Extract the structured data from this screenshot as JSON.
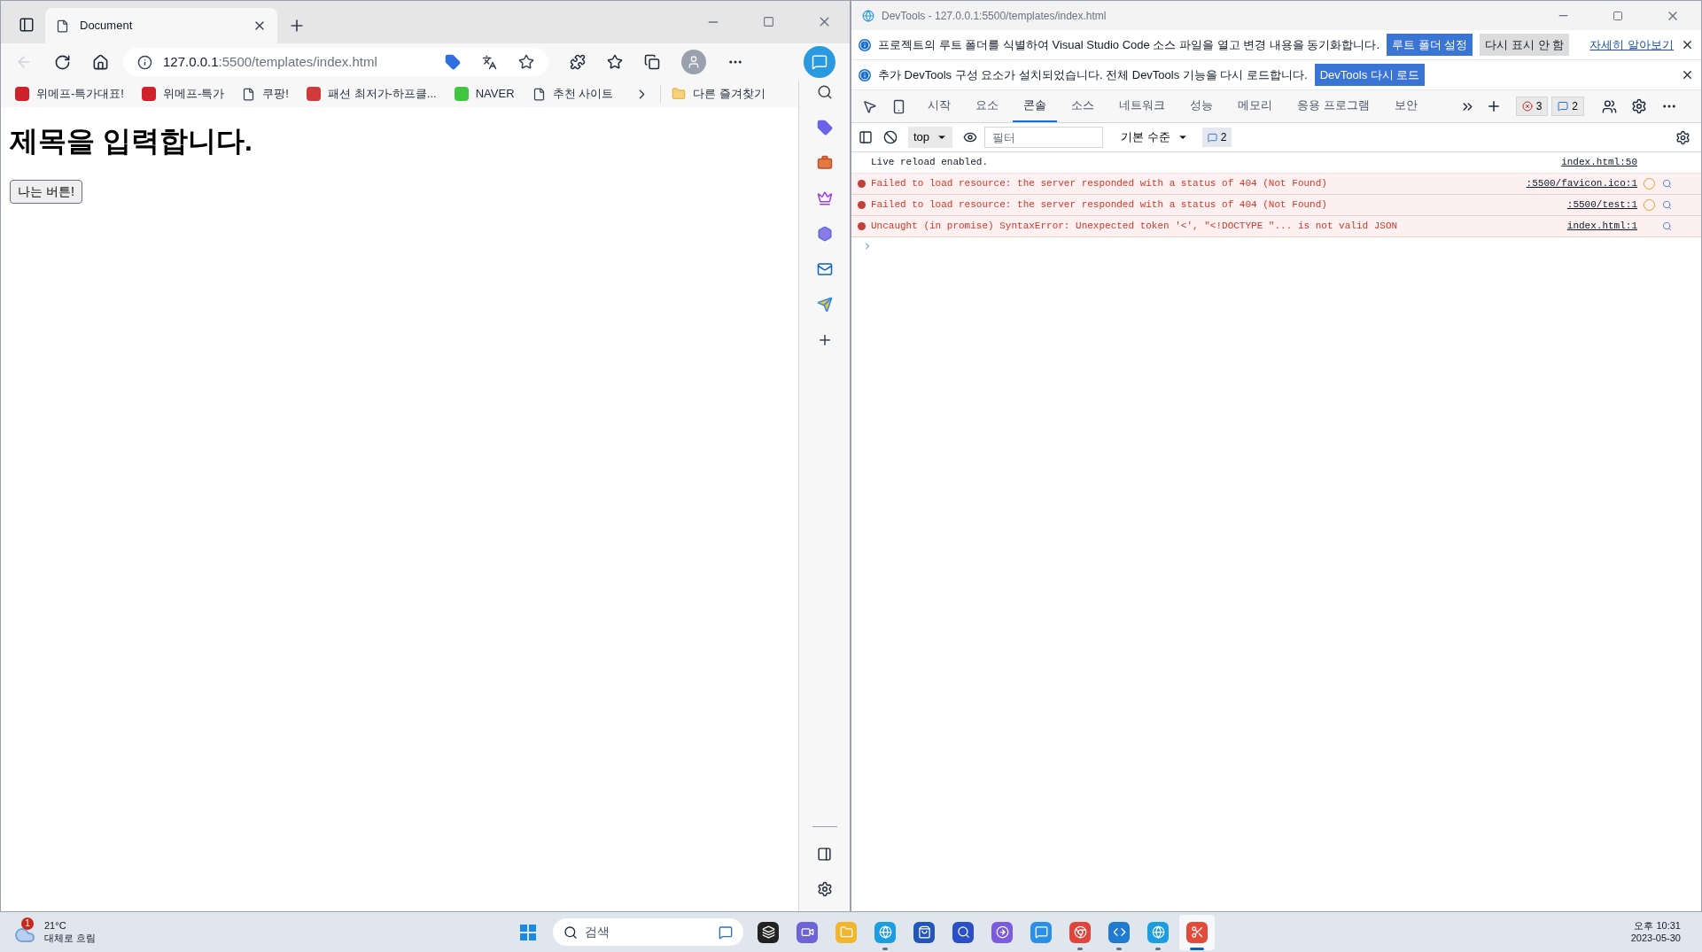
{
  "browser": {
    "tab_title": "Document",
    "address": {
      "host": "127.0.0.1",
      "rest": ":5500/templates/index.html"
    },
    "bookmarks": [
      {
        "label": "위메프-특가대표!",
        "kind": "wemakeprice"
      },
      {
        "label": "위메프-특가",
        "kind": "wemakeprice"
      },
      {
        "label": "쿠팡!",
        "kind": "page"
      },
      {
        "label": "패션 최저가-하프클...",
        "kind": "halfclub"
      },
      {
        "label": "NAVER",
        "kind": "naver"
      },
      {
        "label": "추천 사이트",
        "kind": "page"
      }
    ],
    "other_favorites": "다른 즐겨찾기",
    "page": {
      "heading": "제목을 입력합니다.",
      "button": "나는 버튼!"
    }
  },
  "devtools": {
    "title": "DevTools - 127.0.0.1:5500/templates/index.html",
    "infobars": [
      {
        "text": "프로젝트의 루트 폴더를 식별하여 Visual Studio Code 소스 파일을 열고 변경 내용을 동기화합니다.",
        "buttons": [
          {
            "label": "루트 폴더 설정",
            "primary": true
          },
          {
            "label": "다시 표시 안 함",
            "primary": false
          }
        ],
        "link": "자세히 알아보기"
      },
      {
        "text": "추가 DevTools 구성 요소가 설치되었습니다. 전체 DevTools 기능을 다시 로드합니다.",
        "buttons": [
          {
            "label": "DevTools 다시 로드",
            "primary": true
          }
        ]
      }
    ],
    "tabs": [
      {
        "label": "시작",
        "selected": false
      },
      {
        "label": "요소",
        "selected": false
      },
      {
        "label": "콘솔",
        "selected": true
      },
      {
        "label": "소스",
        "selected": false
      },
      {
        "label": "네트워크",
        "selected": false
      },
      {
        "label": "성능",
        "selected": false
      },
      {
        "label": "메모리",
        "selected": false
      },
      {
        "label": "응용 프로그램",
        "selected": false
      },
      {
        "label": "보안",
        "selected": false
      }
    ],
    "error_count": "3",
    "message_count": "2",
    "context": "top",
    "filter_placeholder": "필터",
    "level": "기본 수준",
    "filter_message_count": "2",
    "messages": [
      {
        "kind": "log",
        "text": "Live reload enabled.",
        "source": "index.html:50",
        "issue": false,
        "search": false
      },
      {
        "kind": "error",
        "text": "Failed to load resource: the server responded with a status of 404 (Not Found)",
        "source": ":5500/favicon.ico:1",
        "issue": true,
        "search": true
      },
      {
        "kind": "error",
        "text": "Failed to load resource: the server responded with a status of 404 (Not Found)",
        "source": ":5500/test:1",
        "issue": true,
        "search": true
      },
      {
        "kind": "error",
        "text": "Uncaught (in promise) SyntaxError: Unexpected token '<', \"<!DOCTYPE \"... is not valid JSON",
        "source": "index.html:1",
        "issue": false,
        "search": true
      }
    ]
  },
  "taskbar": {
    "weather": {
      "badge": "1",
      "temp": "21°C",
      "condition": "대체로 흐림"
    },
    "search_placeholder": "검색",
    "apps": [
      {
        "kind": "files",
        "running": false,
        "selected": false
      },
      {
        "kind": "video",
        "running": false,
        "selected": false
      },
      {
        "kind": "folder",
        "running": false,
        "selected": false
      },
      {
        "kind": "edge",
        "running": true,
        "selected": false
      },
      {
        "kind": "store",
        "running": false,
        "selected": false
      },
      {
        "kind": "search",
        "running": false,
        "selected": false
      },
      {
        "kind": "arrow",
        "running": false,
        "selected": false
      },
      {
        "kind": "bing",
        "running": false,
        "selected": false
      },
      {
        "kind": "chrome",
        "running": true,
        "selected": false
      },
      {
        "kind": "code",
        "running": true,
        "selected": false
      },
      {
        "kind": "edge",
        "running": true,
        "selected": false
      },
      {
        "kind": "snip",
        "running": true,
        "selected": true
      }
    ],
    "time": "오후 10:31",
    "date": "2023-05-30"
  }
}
